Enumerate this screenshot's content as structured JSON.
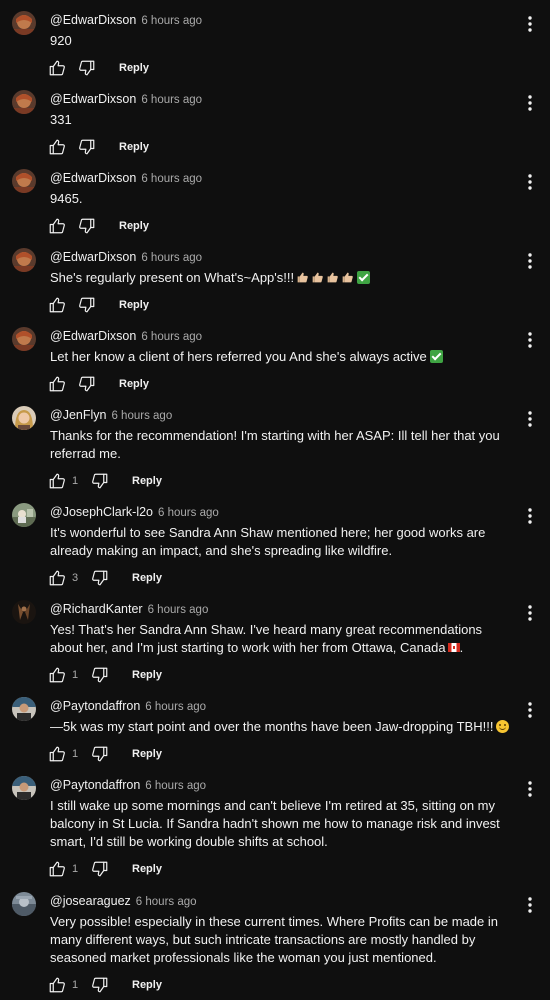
{
  "labels": {
    "reply": "Reply"
  },
  "comments": [
    {
      "author": "@EdwarDixson",
      "time": "6 hours ago",
      "text": "920",
      "likes": "",
      "avatar": "edwar"
    },
    {
      "author": "@EdwarDixson",
      "time": "6 hours ago",
      "text": "331",
      "likes": "",
      "avatar": "edwar"
    },
    {
      "author": "@EdwarDixson",
      "time": "6 hours ago",
      "text": "9465.",
      "likes": "",
      "avatar": "edwar"
    },
    {
      "author": "@EdwarDixson",
      "time": "6 hours ago",
      "text": "She's regularly present on What's~App's!!!",
      "likes": "",
      "avatar": "edwar",
      "emoji": "thumbs-up-x4 check-mark"
    },
    {
      "author": "@EdwarDixson",
      "time": "6 hours ago",
      "text": "Let her know a client of hers referred you And she's always active",
      "likes": "",
      "avatar": "edwar",
      "emoji": "check-mark"
    },
    {
      "author": "@JenFlyn",
      "time": "6 hours ago",
      "text": "Thanks for the recommendation! I'm starting with her ASAP: Ill tell her that you referrad me.",
      "likes": "1",
      "avatar": "jen"
    },
    {
      "author": "@JosephClark-l2o",
      "time": "6 hours ago",
      "text": "It's wonderful to see Sandra Ann Shaw  mentioned here; her good works are already making an impact, and she's spreading like wildfire.",
      "likes": "3",
      "avatar": "joseph"
    },
    {
      "author": "@RichardKanter",
      "time": "6 hours ago",
      "text": "Yes! That's her Sandra Ann Shaw. I've heard many great recommendations about her, and I'm just starting to work with her from Ottawa, Canada",
      "likes": "1",
      "avatar": "richard",
      "emoji": "canada-flag",
      "suffix": "."
    },
    {
      "author": "@Paytondaffron",
      "time": "6 hours ago",
      "text": "—5k was my start point and over the months have been Jaw-dropping TBH!!!",
      "likes": "1",
      "avatar": "payton",
      "emoji": "smiling-face"
    },
    {
      "author": "@Paytondaffron",
      "time": "6 hours ago",
      "text": "I still wake up some mornings and can't believe I'm retired at 35, sitting on my balcony in St Lucia. If Sandra hadn't shown me how to manage risk and invest smart, I'd still be working double shifts at school.",
      "likes": "1",
      "avatar": "payton"
    },
    {
      "author": "@josearaguez",
      "time": "6 hours ago",
      "text": "Very possible! especially in these current times. Where Profits can be made in many different ways, but such intricate transactions are mostly handled by seasoned market professionals like the woman you just mentioned.",
      "likes": "1",
      "avatar": "jose"
    }
  ]
}
